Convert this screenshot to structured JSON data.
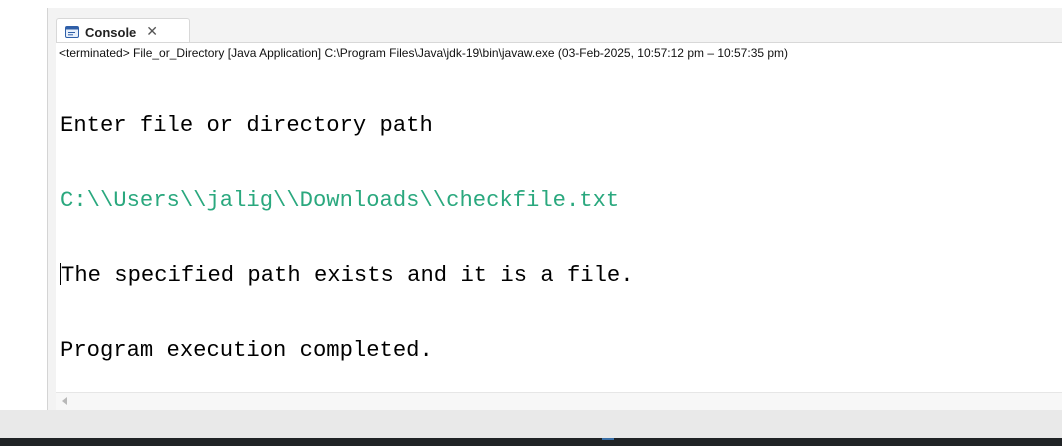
{
  "tab": {
    "label": "Console",
    "icon": "console-icon",
    "close_icon": "close-icon"
  },
  "status": {
    "text": "<terminated> File_or_Directory [Java Application] C:\\Program Files\\Java\\jdk-19\\bin\\javaw.exe  (03-Feb-2025, 10:57:12 pm – 10:57:35 pm)"
  },
  "console": {
    "lines": [
      "Enter file or directory path",
      "C:\\\\Users\\\\jalig\\\\Downloads\\\\checkfile.txt",
      "The specified path exists and it is a file.",
      "Program execution completed."
    ]
  },
  "colors": {
    "prompt_text": "#000000",
    "user_input_text": "#2aa87e",
    "panel_background": "#ffffff",
    "view_background": "#f3f3f3"
  }
}
